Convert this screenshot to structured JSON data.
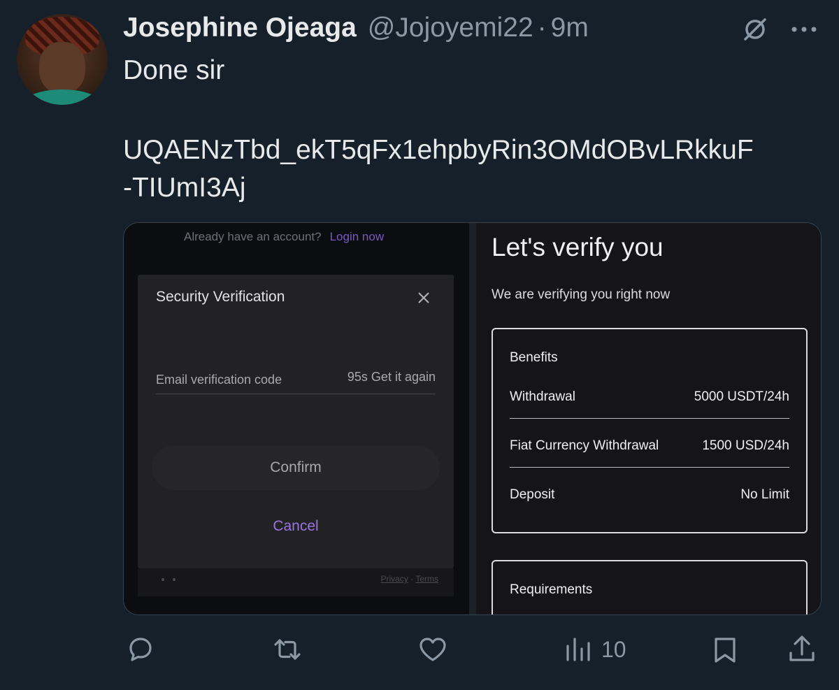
{
  "tweet": {
    "author_name": "Josephine Ojeaga",
    "handle": "@Jojoyemi22",
    "separator": "·",
    "time": "9m",
    "text_line1": "Done sir",
    "text_line2": "UQAENzTbd_ekT5qFx1ehpbyRin3OMdOBvLRkkuF",
    "text_line3": "-TIUmI3Aj"
  },
  "media_left": {
    "already_text": "Already have an account?",
    "login_link": "Login now",
    "modal_title": "Security Verification",
    "field_label": "Email verification code",
    "field_suffix": "95s Get it again",
    "confirm_label": "Confirm",
    "cancel_label": "Cancel",
    "privacy": "Privacy",
    "dot": "·",
    "terms": "Terms"
  },
  "media_right": {
    "title": "Let's verify you",
    "subtitle": "We are verifying you right now",
    "benefits_title": "Benefits",
    "rows": [
      {
        "label": "Withdrawal",
        "value": "5000 USDT/24h"
      },
      {
        "label": "Fiat Currency Withdrawal",
        "value": "1500 USD/24h"
      },
      {
        "label": "Deposit",
        "value": "No Limit"
      }
    ],
    "requirements_title": "Requirements"
  },
  "actions": {
    "views": "10"
  },
  "icons": {
    "reply": "reply-icon",
    "retweet": "retweet-icon",
    "like": "heart-icon",
    "views": "analytics-icon",
    "bookmark": "bookmark-icon",
    "share": "share-icon",
    "grok": "grok-icon",
    "more": "more-icon"
  },
  "colors": {
    "background": "#15202b",
    "muted": "#8b98a5",
    "accent_purple": "#9a74e0"
  }
}
